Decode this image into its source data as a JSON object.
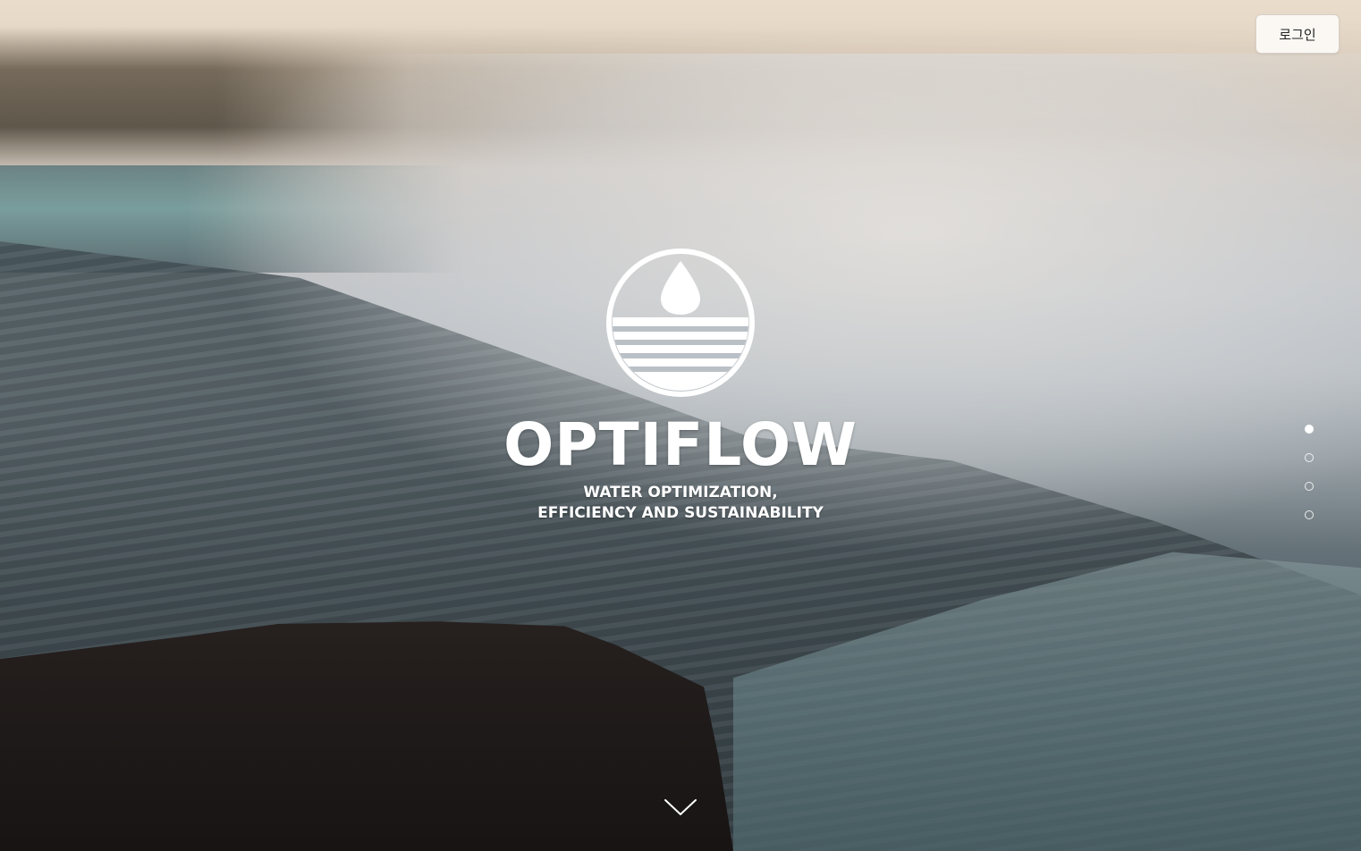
{
  "header": {
    "login_label": "로그인"
  },
  "hero": {
    "brand": "OPTIFLOW",
    "tagline_line1": "WATER OPTIMIZATION,",
    "tagline_line2": "EFFICIENCY AND SUSTAINABILITY",
    "logo_icon": "water-drop-horizon-logo"
  },
  "pagination": {
    "total": 4,
    "active_index": 0
  },
  "scroll_icon": "chevron-down-icon",
  "colors": {
    "text": "#ffffff",
    "login_bg": "#fbf8f4"
  }
}
